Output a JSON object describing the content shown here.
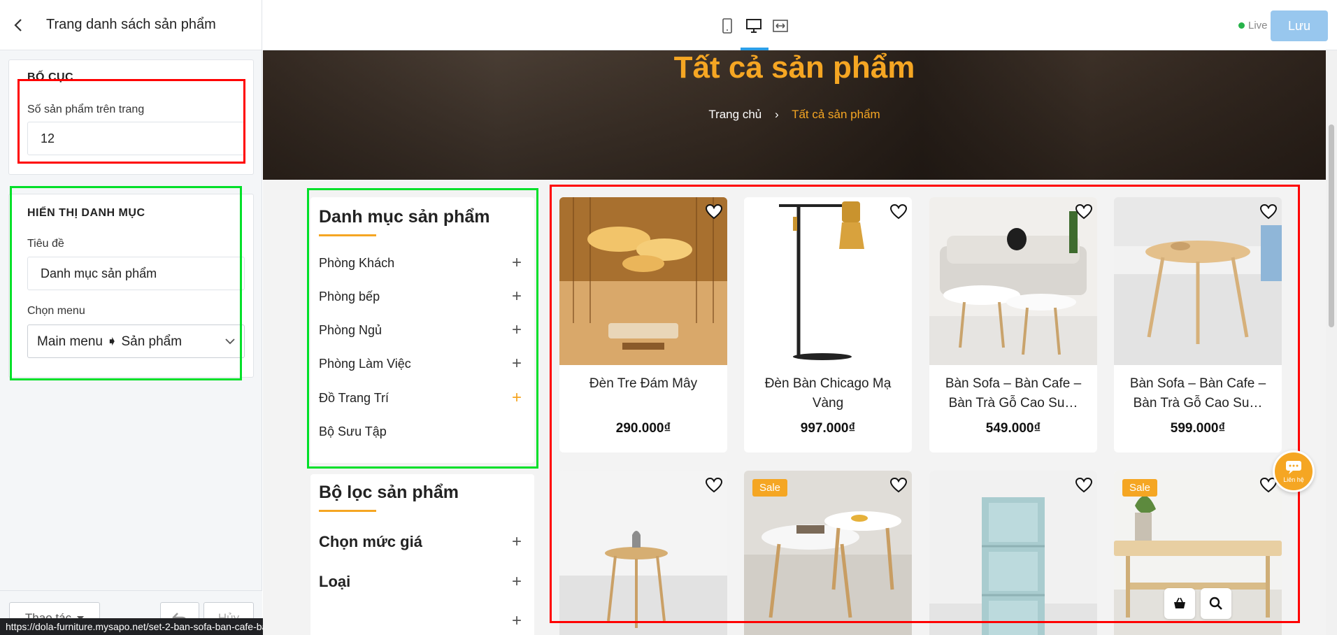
{
  "panel": {
    "title": "Trang danh sách sản phẩm",
    "layout_section": {
      "heading": "BỐ CỤC",
      "products_per_page_label": "Số sản phẩm trên trang",
      "products_per_page_value": "12"
    },
    "category_section": {
      "heading": "HIỂN THỊ DANH MỤC",
      "title_label": "Tiêu đề",
      "title_value": "Danh mục sản phẩm",
      "menu_label": "Chọn menu",
      "menu_value": "Main menu ➧ Sản phẩm"
    },
    "footer": {
      "actions_label": "Thao tác",
      "cancel_label": "Hủy"
    },
    "status_url": "https://dola-furniture.mysapo.net/set-2-ban-sofa-ban-cafe-ban-tra-go-cao-su"
  },
  "toolbar": {
    "live_label": "Live",
    "save_label": "Lưu",
    "active_device": "desktop"
  },
  "preview": {
    "hero_title": "Tất cả sản phẩm",
    "breadcrumb": {
      "home": "Trang chủ",
      "separator": "›",
      "current": "Tất cả sản phẩm"
    },
    "category_box": {
      "title": "Danh mục sản phẩm",
      "items": [
        {
          "label": "Phòng Khách",
          "expandable": true
        },
        {
          "label": "Phòng bếp",
          "expandable": true
        },
        {
          "label": "Phòng Ngủ",
          "expandable": true
        },
        {
          "label": "Phòng Làm Việc",
          "expandable": true
        },
        {
          "label": "Đồ Trang Trí",
          "expandable": true,
          "highlighted": true
        },
        {
          "label": "Bộ Sưu Tập",
          "expandable": false
        }
      ]
    },
    "filter_box": {
      "title": "Bộ lọc sản phẩm",
      "items": [
        {
          "label": "Chọn mức giá"
        },
        {
          "label": "Loại"
        }
      ]
    },
    "products": [
      {
        "name": "Đèn Tre Đám Mây",
        "price": "290.000₫",
        "sale": false
      },
      {
        "name": "Đèn Bàn Chicago Mạ Vàng",
        "price": "997.000₫",
        "sale": false
      },
      {
        "name": "Bàn Sofa – Bàn Cafe – Bàn Trà Gỗ Cao Su…",
        "price": "549.000₫",
        "sale": false
      },
      {
        "name": "Bàn Sofa – Bàn Cafe – Bàn Trà Gỗ Cao Su…",
        "price": "599.000₫",
        "sale": false
      },
      {
        "name": "",
        "price": "",
        "sale": false
      },
      {
        "name": "",
        "price": "",
        "sale": true,
        "sale_label": "Sale"
      },
      {
        "name": "",
        "price": "",
        "sale": false
      },
      {
        "name": "",
        "price": "",
        "sale": true,
        "sale_label": "Sale"
      }
    ],
    "chat_label": "Liên hệ"
  },
  "colors": {
    "accent_orange": "#f5a623",
    "highlight_red": "#ff0000",
    "highlight_green": "#00e029",
    "save_button": "#98c7ee",
    "live_dot": "#27b34a"
  }
}
